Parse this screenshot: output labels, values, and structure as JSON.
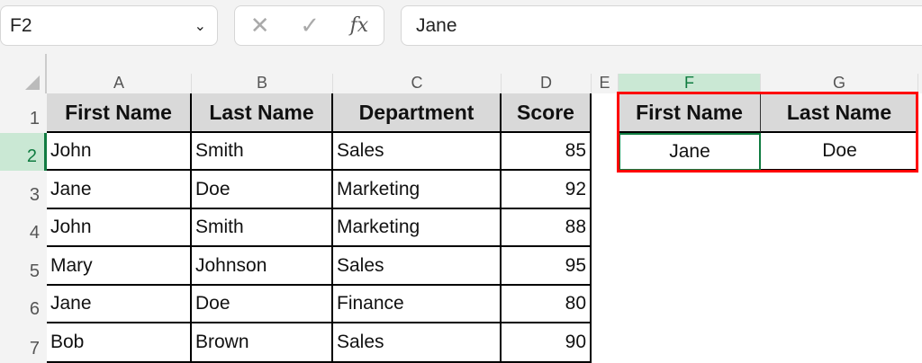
{
  "formula_bar": {
    "name_box": "F2",
    "cancel": "✕",
    "enter": "✓",
    "fx": "fx",
    "content": "Jane"
  },
  "columns": [
    "A",
    "B",
    "C",
    "D",
    "E",
    "F",
    "G"
  ],
  "rows": [
    "1",
    "2",
    "3",
    "4",
    "5",
    "6",
    "7"
  ],
  "table": {
    "headers": [
      "First Name",
      "Last Name",
      "Department",
      "Score"
    ],
    "data": [
      [
        "John",
        "Smith",
        "Sales",
        "85"
      ],
      [
        "Jane",
        "Doe",
        "Marketing",
        "92"
      ],
      [
        "John",
        "Smith",
        "Marketing",
        "88"
      ],
      [
        "Mary",
        "Johnson",
        "Sales",
        "95"
      ],
      [
        "Jane",
        "Doe",
        "Finance",
        "80"
      ],
      [
        "Bob",
        "Brown",
        "Sales",
        "90"
      ]
    ]
  },
  "result": {
    "headers": [
      "First Name",
      "Last Name"
    ],
    "values": [
      "Jane",
      "Doe"
    ]
  },
  "colors": {
    "selection": "#107c41",
    "highlight": "#ff0000",
    "header_fill": "#d9d9d9"
  }
}
